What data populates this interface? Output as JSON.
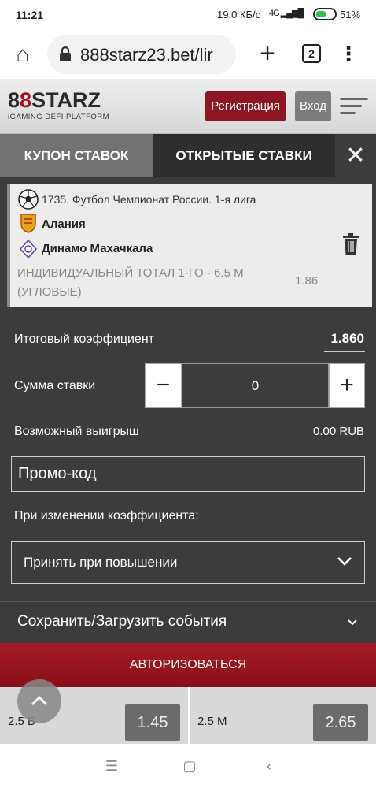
{
  "status": {
    "time": "11:21",
    "network_speed": "19,0 КБ/с",
    "signal": "4G",
    "battery": "51%"
  },
  "browser": {
    "url": "888starz23.bet/lir",
    "tab_count": "2"
  },
  "header": {
    "logo_part1": "8",
    "logo_part2": "8",
    "logo_part3": "STARZ",
    "logo_sub": "iGAMING DEFI PLATFORM",
    "register_label": "Регистрация",
    "login_label": "Вход"
  },
  "tabs": {
    "coupon": "КУПОН СТАВОК",
    "open_bets": "ОТКРЫТЫЕ СТАВКИ"
  },
  "coupon": {
    "league": "1735. Футбол Чемпионат России. 1-я лига",
    "team1": "Алания",
    "team2": "Динамо Махачкала",
    "market": "ИНДИВИДУАЛЬНЫЙ ТОТАЛ 1-ГО - 6.5 М (УГЛОВЫЕ)",
    "odds": "1.86"
  },
  "bet": {
    "total_coef_label": "Итоговый коэффициент",
    "total_coef_value": "1.860",
    "stake_label": "Сумма ставки",
    "stake_value": "0",
    "win_label": "Возможный выигрыш",
    "win_value": "0.00 RUB",
    "promo_placeholder": "Промо-код",
    "coef_change_label": "При изменении коэффициента:",
    "coef_change_option": "Принять при повышении",
    "save_label": "Сохранить/Загрузить события",
    "auth_label": "АВТОРИЗОВАТЬСЯ"
  },
  "bottom": {
    "left_label": "2.5 Б",
    "left_odds": "1.45",
    "right_label": "2.5 М",
    "right_odds": "2.65"
  },
  "colors": {
    "brand_red": "#8d1622",
    "panel_dark": "#3c3c3c"
  }
}
